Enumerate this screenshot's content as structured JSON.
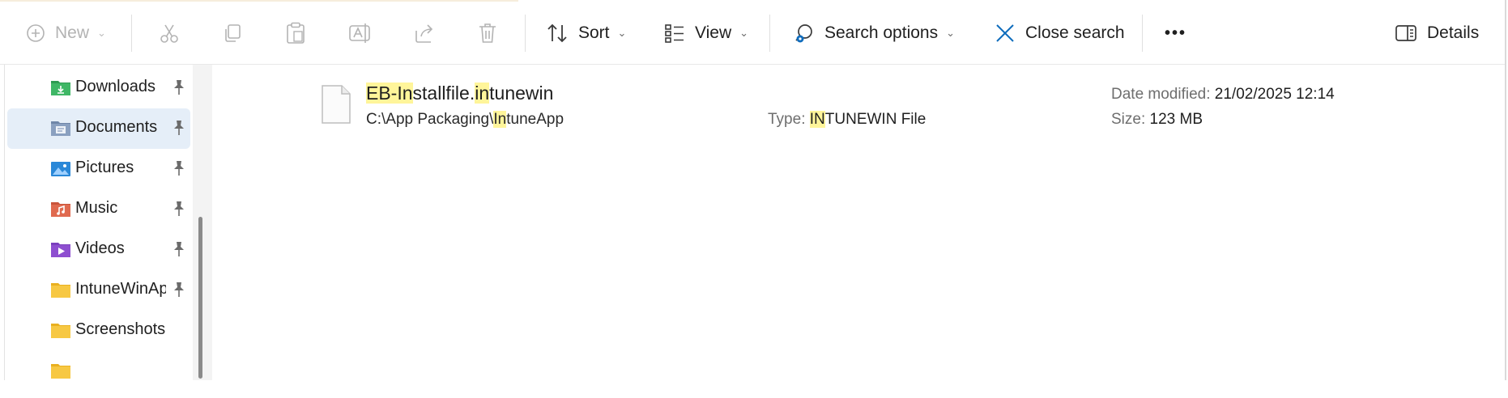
{
  "toolbar": {
    "new_label": "New",
    "sort_label": "Sort",
    "view_label": "View",
    "search_options_label": "Search options",
    "close_search_label": "Close search",
    "more_label": "•••",
    "details_label": "Details"
  },
  "sidebar": {
    "items": [
      {
        "label": "Downloads",
        "icon": "downloads-folder-icon",
        "pinned": true,
        "color": "#2e9b52"
      },
      {
        "label": "Documents",
        "icon": "documents-folder-icon",
        "pinned": true,
        "selected": true,
        "color": "#6f86a8"
      },
      {
        "label": "Pictures",
        "icon": "pictures-folder-icon",
        "pinned": true,
        "color": "#2a88d8"
      },
      {
        "label": "Music",
        "icon": "music-folder-icon",
        "pinned": true,
        "color": "#e06a4f"
      },
      {
        "label": "Videos",
        "icon": "videos-folder-icon",
        "pinned": true,
        "color": "#8e4fd0"
      },
      {
        "label": "IntuneWinAp",
        "icon": "folder-icon",
        "pinned": true,
        "color": "#f7c843"
      },
      {
        "label": "Screenshots",
        "icon": "folder-icon",
        "pinned": false,
        "color": "#f7c843"
      }
    ]
  },
  "result": {
    "name_parts": [
      "EB-",
      "In",
      "stallfile.",
      "in",
      "tunewin"
    ],
    "path_parts": [
      "C:\\App Packaging\\",
      "In",
      "tuneApp"
    ],
    "type_label": "Type:",
    "type_parts": [
      "IN",
      "TUNEWIN File"
    ],
    "date_label": "Date modified:",
    "date_value": "21/02/2025 12:14",
    "size_label": "Size:",
    "size_value": "123 MB"
  },
  "colors": {
    "highlight": "#fff59a",
    "selected_bg": "#e5eef8",
    "accent": "#0f6cbd"
  }
}
